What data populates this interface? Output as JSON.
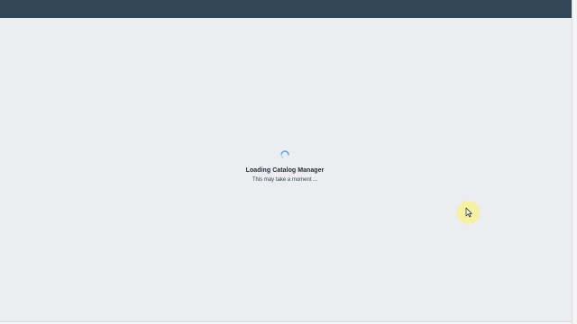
{
  "window": {
    "top_bar_color": "#334657",
    "background_color": "#ebedf0"
  },
  "loader": {
    "title": "Loading Catalog Manager",
    "subtitle": "This may take a moment ...",
    "icon": "loading-spinner-icon",
    "accent_color": "#5aa1e3"
  },
  "cursor": {
    "icon": "mouse-pointer-icon",
    "highlight_color": "#f7f096"
  }
}
